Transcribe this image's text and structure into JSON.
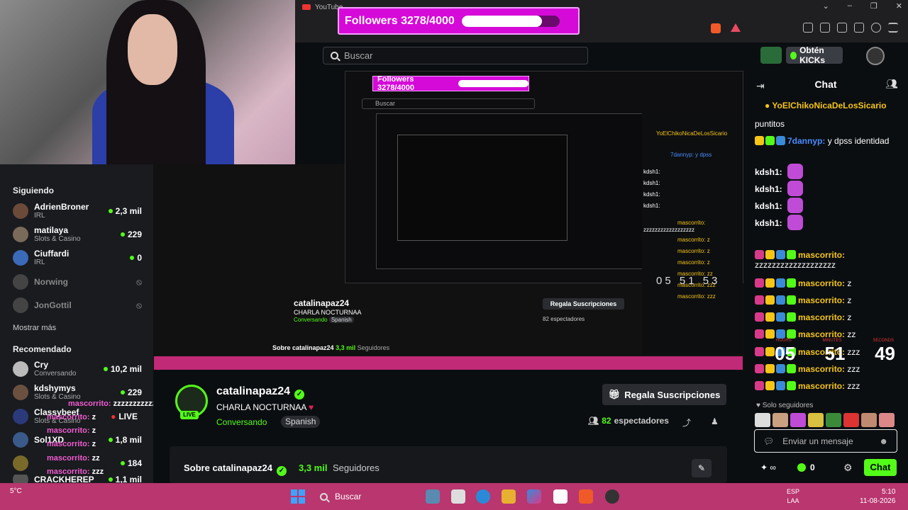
{
  "browser": {
    "tab_title": "YouTube",
    "search_placeholder": "Buscar"
  },
  "header": {
    "get_kicks_label": "Obtén KICKs"
  },
  "followers_goal": {
    "label": "Followers 3278/4000",
    "current": 3278,
    "goal": 4000,
    "fill_percent": 82
  },
  "sidebar": {
    "following_heading": "Siguiendo",
    "following": [
      {
        "name": "AdrienBroner",
        "category": "IRL",
        "viewers": "2,3 mil",
        "live": true
      },
      {
        "name": "matilaya",
        "category": "Slots & Casino",
        "viewers": "229",
        "live": true
      },
      {
        "name": "Ciuffardi",
        "category": "IRL",
        "viewers": "0",
        "live": true
      },
      {
        "name": "Norwing",
        "category": "",
        "viewers": "",
        "live": false
      },
      {
        "name": "JonGottil",
        "category": "",
        "viewers": "",
        "live": false
      }
    ],
    "show_more": "Mostrar más",
    "recommended_heading": "Recomendado",
    "recommended": [
      {
        "name": "Cry",
        "category": "Conversando",
        "viewers": "10,2 mil"
      },
      {
        "name": "kdshymys",
        "category": "Slots & Casino",
        "viewers": "229"
      },
      {
        "name": "Classybeef",
        "category": "Slots & Casino",
        "viewers": "LIVE"
      },
      {
        "name": "Sol1XD",
        "category": "",
        "viewers": "1,8 mil"
      },
      {
        "name": "",
        "category": "",
        "viewers": "184"
      },
      {
        "name": "CRACKHEREP",
        "category": "",
        "viewers": "1,1 mil"
      }
    ]
  },
  "recursion": {
    "followers_label": "Followers 3278/4000",
    "search": "Buscar",
    "streamer": "catalinapaz24",
    "title": "CHARLA NOCTURNAA",
    "category": "Conversando",
    "language": "Spanish",
    "gift": "Regala Suscripciones",
    "viewers": "82 espectadores",
    "about": "Sobre catalinapaz24",
    "followers": "3,3 mil",
    "followers_label2": "Seguidores",
    "timer": "05 51 53",
    "chat_lines": [
      "YoElChikoNicaDeLosSicario",
      "7dannyp: y dpss",
      "kdsh1:",
      "kdsh1:",
      "kdsh1:",
      "kdsh1:",
      "mascorrito:",
      "zzzzzzzzzzzzzzzzzz",
      "mascorrito: z",
      "mascorrito: z",
      "mascorrito: z",
      "mascorrito: zz",
      "mascorrito: zzz",
      "mascorrito: zzz"
    ]
  },
  "stream": {
    "live_badge": "LIVE",
    "streamer": "catalinapaz24",
    "title": "CHARLA NOCTURNAA",
    "category": "Conversando",
    "language": "Spanish",
    "gift_label": "Regala Suscripciones",
    "viewers_count": "82",
    "viewers_label": "espectadores",
    "about_title": "Sobre catalinapaz24",
    "followers_count": "3,3 mil",
    "followers_label": "Seguidores"
  },
  "chat": {
    "title": "Chat",
    "pinned_user": "YoElChikoNicaDeLosSicario",
    "messages": [
      {
        "user": "",
        "text": "puntitos",
        "color": "#ffffff"
      },
      {
        "user": "7dannyp:",
        "text": "y dpss identidad",
        "color": "#4a8cff"
      },
      {
        "user": "kdsh1:",
        "text": "",
        "color": "#ffffff"
      },
      {
        "user": "kdsh1:",
        "text": "",
        "color": "#ffffff"
      },
      {
        "user": "kdsh1:",
        "text": "",
        "color": "#ffffff"
      },
      {
        "user": "kdsh1:",
        "text": "",
        "color": "#ffffff"
      },
      {
        "user": "mascorrito:",
        "text": "zzzzzzzzzzzzzzzzzzz",
        "color": "#f5c518"
      },
      {
        "user": "mascorrito:",
        "text": "z",
        "color": "#f5c518"
      },
      {
        "user": "mascorrito:",
        "text": "z",
        "color": "#f5c518"
      },
      {
        "user": "mascorrito:",
        "text": "z",
        "color": "#f5c518"
      },
      {
        "user": "mascorrito:",
        "text": "zz",
        "color": "#f5c518"
      },
      {
        "user": "mascorrito:",
        "text": "zzz",
        "color": "#f5c518"
      },
      {
        "user": "mascorrito:",
        "text": "zzz",
        "color": "#f5c518"
      },
      {
        "user": "mascorrito:",
        "text": "zzz",
        "color": "#f5c518"
      }
    ],
    "timer": {
      "hours": "05",
      "minutes": "51",
      "seconds": "49",
      "labels": [
        "HOURS",
        "MINUTES",
        "SECONDS"
      ]
    },
    "followers_only": "Solo seguidores",
    "input_placeholder": "Enviar un mensaje",
    "points": "∞",
    "kicks": "0",
    "send_label": "Chat"
  },
  "overlay_chat": [
    {
      "user": "mascorrito",
      "text": "zzzzzzzzzzzzzzzzzzzz"
    },
    {
      "user": "mascorrito",
      "text": "z"
    },
    {
      "user": "mascorrito",
      "text": "z"
    },
    {
      "user": "mascorrito",
      "text": "z"
    },
    {
      "user": "mascorrito",
      "text": "zz"
    },
    {
      "user": "mascorrito",
      "text": "zzz"
    },
    {
      "user": "mascorrito",
      "text": "zzz"
    }
  ],
  "taskbar": {
    "weather": "5°C",
    "search_label": "Buscar",
    "lang": "ESP",
    "region": "LAA",
    "time": "5:10",
    "date": "11-08-2026"
  },
  "colors": {
    "kick_green": "#53fc18",
    "followers_pink": "#d60ad8",
    "taskbar": "#b9366f",
    "overlay_user": "#f25cd1"
  }
}
